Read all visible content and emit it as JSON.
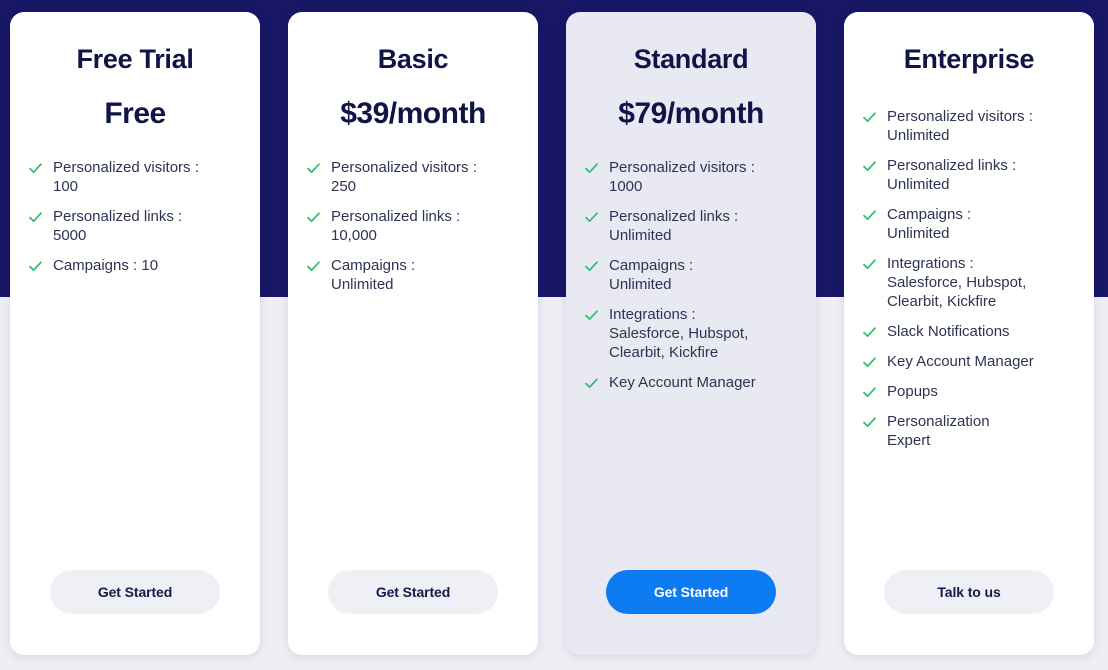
{
  "theme": {
    "hero_band_color": "#171766",
    "page_background": "#eeeef4",
    "card_background": "#ffffff",
    "featured_card_background": "#e9e9f4",
    "heading_color": "#101446",
    "feature_text_color": "#2c3452",
    "check_color": "#2bbd6a",
    "primary_button_color": "#0d7cf2",
    "secondary_button_color": "#eff0f5"
  },
  "icons": {
    "check": "check-icon"
  },
  "plans": [
    {
      "id": "free-trial",
      "title": "Free Trial",
      "price": "Free",
      "featured": false,
      "features": [
        "Personalized visitors :\n100",
        "Personalized links :\n5000",
        "Campaigns : 10"
      ],
      "cta_label": "Get Started",
      "cta_style": "secondary"
    },
    {
      "id": "basic",
      "title": "Basic",
      "price": "$39/month",
      "featured": false,
      "features": [
        "Personalized visitors :\n250",
        "Personalized links :\n10,000",
        "Campaigns :\nUnlimited"
      ],
      "cta_label": "Get Started",
      "cta_style": "secondary"
    },
    {
      "id": "standard",
      "title": "Standard",
      "price": "$79/month",
      "featured": true,
      "features": [
        "Personalized visitors :\n1000",
        "Personalized links :\nUnlimited",
        "Campaigns :\nUnlimited",
        "Integrations :\n Salesforce, Hubspot,\nClearbit, Kickfire",
        "Key Account Manager"
      ],
      "cta_label": "Get Started",
      "cta_style": "primary"
    },
    {
      "id": "enterprise",
      "title": "Enterprise",
      "price": "",
      "featured": false,
      "features": [
        "Personalized visitors :\nUnlimited",
        "Personalized links :\nUnlimited",
        "Campaigns :\nUnlimited",
        "Integrations :\n Salesforce, Hubspot,\nClearbit, Kickfire",
        "Slack Notifications",
        "Key Account Manager",
        "Popups",
        "Personalization\nExpert"
      ],
      "cta_label": "Talk to us",
      "cta_style": "secondary"
    }
  ]
}
